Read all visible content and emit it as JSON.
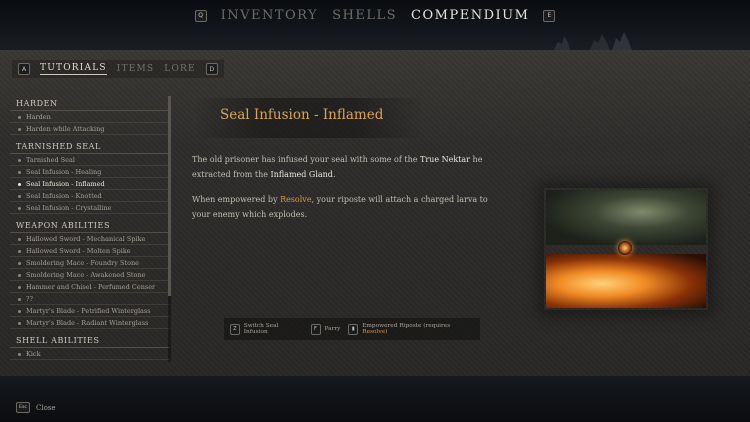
{
  "top_tabs": {
    "left_key": "Q",
    "right_key": "E",
    "items": [
      {
        "label": "INVENTORY",
        "active": false
      },
      {
        "label": "SHELLS",
        "active": false
      },
      {
        "label": "COMPENDIUM",
        "active": true
      }
    ]
  },
  "sub_tabs": {
    "left_key": "A",
    "right_key": "D",
    "items": [
      {
        "label": "TUTORIALS",
        "active": true
      },
      {
        "label": "ITEMS",
        "active": false
      },
      {
        "label": "LORE",
        "active": false
      }
    ]
  },
  "sidebar": {
    "categories": [
      {
        "title": "HARDEN",
        "items": [
          "Harden",
          "Harden while Attacking"
        ]
      },
      {
        "title": "TARNISHED SEAL",
        "items": [
          "Tarnished Seal",
          "Seal Infusion - Healing",
          "Seal Infusion - Inflamed",
          "Seal Infusion - Knotted",
          "Seal Infusion - Crystalline"
        ]
      },
      {
        "title": "WEAPON ABILITIES",
        "items": [
          "Hallowed Sword - Mechanical Spike",
          "Hallowed Sword - Molten Spike",
          "Smoldering Mace - Foundry Stone",
          "Smoldering Mace - Awakened Stone",
          "Hammer and Chisel - Perfumed Censer",
          "??",
          "Martyr's Blade - Petrified Winterglass",
          "Martyr's Blade - Radiant Winterglass"
        ]
      },
      {
        "title": "SHELL ABILITIES",
        "items": [
          "Kick"
        ]
      }
    ],
    "selected": "Seal Infusion - Inflamed"
  },
  "content": {
    "title": "Seal Infusion - Inflamed",
    "para1": {
      "pre": "The old prisoner has infused your seal with some of the ",
      "term1": "True Nektar",
      "mid": " he extracted from the ",
      "term2": "Inflamed Gland",
      "post": "."
    },
    "para2": {
      "pre": "When empowered by ",
      "term": "Resolve",
      "post": ", your riposte will attach a charged larva to your enemy which explodes."
    }
  },
  "hints": [
    {
      "key": "Z",
      "label": "Switch Seal Infusion"
    },
    {
      "key": "F",
      "label": "Parry"
    },
    {
      "key": "▮",
      "label": "Empowered Riposte (requires ",
      "accent": "Resolve",
      "suffix": ")"
    }
  ],
  "footer": {
    "key": "Esc",
    "label": "Close"
  },
  "colors": {
    "accent": "#d59a45",
    "title": "#d9a55a"
  }
}
